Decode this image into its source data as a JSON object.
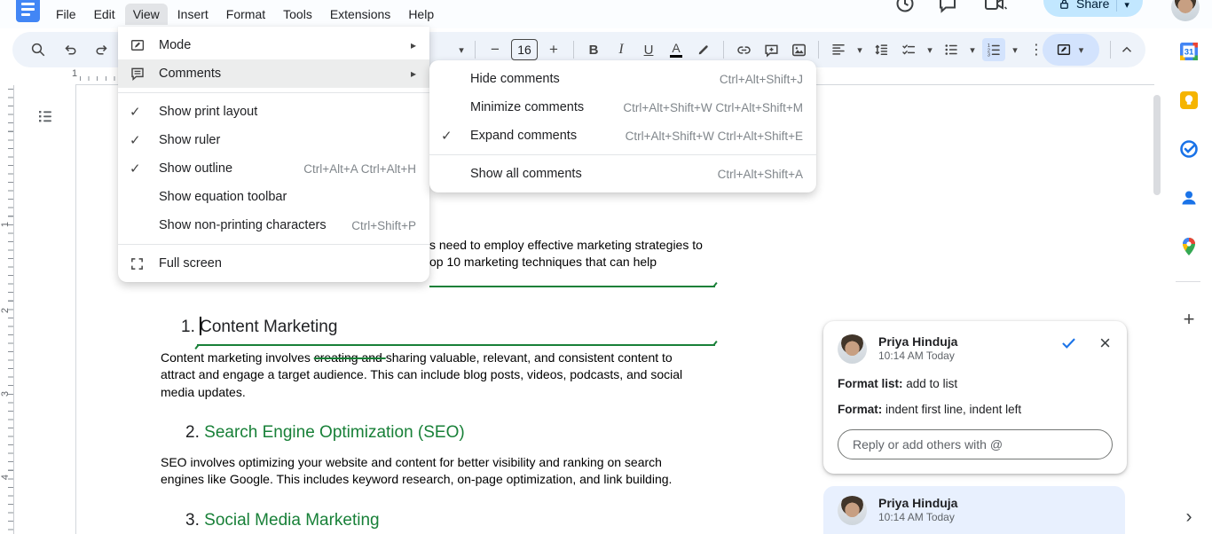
{
  "icons": {
    "caret_down": "▾",
    "submenu_arrow": "▸",
    "check": "✓",
    "more_vertical": "⋮",
    "plus": "+",
    "minus": "−",
    "close": "×",
    "chevron_right": "›"
  },
  "topbar": {
    "menus": [
      "File",
      "Edit",
      "View",
      "Insert",
      "Format",
      "Tools",
      "Extensions",
      "Help"
    ],
    "active_menu": "View",
    "share_label": "Share"
  },
  "toolbar": {
    "font_size": "16",
    "bold": "B",
    "italic": "I",
    "underline": "U",
    "text_color_letter": "A"
  },
  "view_menu": {
    "items": [
      {
        "label": "Mode",
        "icon": "mode-icon",
        "has_submenu": true
      },
      {
        "label": "Comments",
        "icon": "comments-icon",
        "has_submenu": true,
        "highlighted": true
      },
      {
        "label": "Show print layout",
        "checked": true
      },
      {
        "label": "Show ruler",
        "checked": true
      },
      {
        "label": "Show outline",
        "checked": true,
        "shortcut": "Ctrl+Alt+A Ctrl+Alt+H"
      },
      {
        "label": "Show equation toolbar"
      },
      {
        "label": "Show non-printing characters",
        "shortcut": "Ctrl+Shift+P"
      },
      {
        "label": "Full screen",
        "icon": "fullscreen-icon"
      }
    ]
  },
  "comments_submenu": {
    "items": [
      {
        "label": "Hide comments",
        "shortcut": "Ctrl+Alt+Shift+J"
      },
      {
        "label": "Minimize comments",
        "shortcut": "Ctrl+Alt+Shift+W Ctrl+Alt+Shift+M"
      },
      {
        "label": "Expand comments",
        "shortcut": "Ctrl+Alt+Shift+W Ctrl+Alt+Shift+E",
        "checked": true
      },
      {
        "label": "Show all comments",
        "shortcut": "Ctrl+Alt+Shift+A"
      }
    ]
  },
  "rulers": {
    "horizontal_numbers": [
      "1"
    ],
    "vertical_numbers": [
      "1",
      "2",
      "3",
      "4"
    ]
  },
  "document": {
    "intro_line1": "s need to employ effective marketing strategies to",
    "intro_line2": "op 10 marketing techniques that can help",
    "heading1": {
      "number": "1.",
      "text": "Content Marketing"
    },
    "paragraph1": {
      "l1_before": "Content marketing involves ",
      "l1_struck": "creating and ",
      "l1_after": "sharing valuable, relevant, and consistent content to",
      "l2": "attract and engage a target audience. This can include blog posts, videos, podcasts, and social",
      "l3": "media updates."
    },
    "heading2": {
      "number": "2.",
      "text": "Search Engine Optimization (SEO)"
    },
    "paragraph2": {
      "l1": "SEO involves optimizing your website and content for better visibility and ranking on search",
      "l2": "engines like Google. This includes keyword research, on-page optimization, and link building."
    },
    "heading3": {
      "number": "3.",
      "text": "Social Media Marketing"
    }
  },
  "comments_panel": {
    "card1": {
      "author": "Priya Hinduja",
      "time": "10:14 AM Today",
      "line1_label": "Format list:",
      "line1_text": "add to list",
      "line2_label": "Format:",
      "line2_text": "indent first line, indent left",
      "reply_placeholder": "Reply or add others with @"
    },
    "card2": {
      "author": "Priya Hinduja",
      "time": "10:14 AM Today"
    }
  },
  "side_rail": {
    "calendar_label": "31"
  },
  "colors": {
    "accent_green": "#188038",
    "accent_blue": "#1a73e8",
    "share_bg": "#c2e7ff",
    "selected_bg": "#d3e3fd"
  }
}
